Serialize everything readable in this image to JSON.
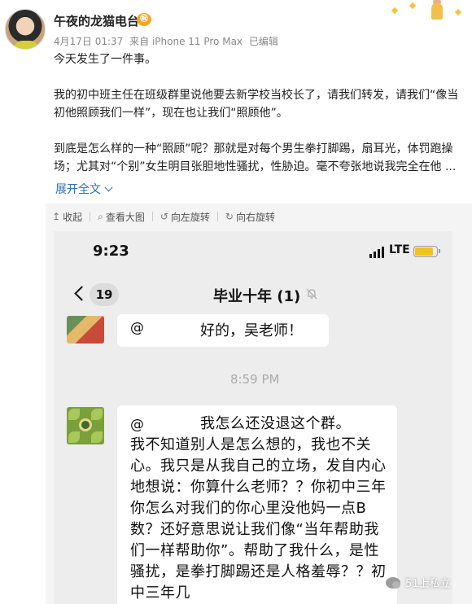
{
  "post": {
    "username": "午夜的龙猫电台",
    "vip_badge": "㊗",
    "meta": {
      "date": "4月17日 01:37",
      "source": "来自 iPhone 11 Pro Max",
      "edited": "已编辑"
    },
    "paragraphs": [
      "今天发生了一件事。",
      "我的初中班主任在班级群里说他要去新学校当校长了，请我们转发，请我们“像当初他照顾我们一样”，现在也让我们“照顾他”。",
      "到底是怎么样的一种“照顾”呢？那就是对每个男生拳打脚踢，扇耳光，体罚跑操场；尤其对“个别”女生明目张胆地性骚扰，性胁迫。毫不夸张地说我完全在他 ..."
    ],
    "expand_label": "展开全文"
  },
  "image_toolbar": {
    "items": [
      {
        "icon": "↥",
        "label": "收起"
      },
      {
        "icon": "⌕",
        "label": "查看大图"
      },
      {
        "icon": "↺",
        "label": "向左旋转"
      },
      {
        "icon": "↻",
        "label": "向右旋转"
      }
    ]
  },
  "phone": {
    "status_time": "9:23",
    "network": "LTE",
    "battery_level": 0.85,
    "unread_count": "19",
    "group_title": "毕业十年 (1)",
    "messages": [
      {
        "at": "@",
        "text": "好的，吴老师！"
      },
      {
        "at": "@",
        "text_first_line": "我怎么还没退这个群。",
        "text_rest": "我不知道别人是怎么想的，我也不关心。我只是从我自己的立场，发自内心地想说：你算什么老师？？你初中三年你怎么对我们的你心里没他妈一点B数？还好意思说让我们像“当年帮助我们一样帮助你”。帮助了我什么，是性骚扰，是拳打脚踢还是人格羞辱？？初中三年几"
      }
    ],
    "timestamp": "8:59 PM"
  },
  "watermark": "51上私立",
  "colors": {
    "link": "#2f6fb5",
    "vip": "#f6a623",
    "battery": "#f2c21b"
  }
}
